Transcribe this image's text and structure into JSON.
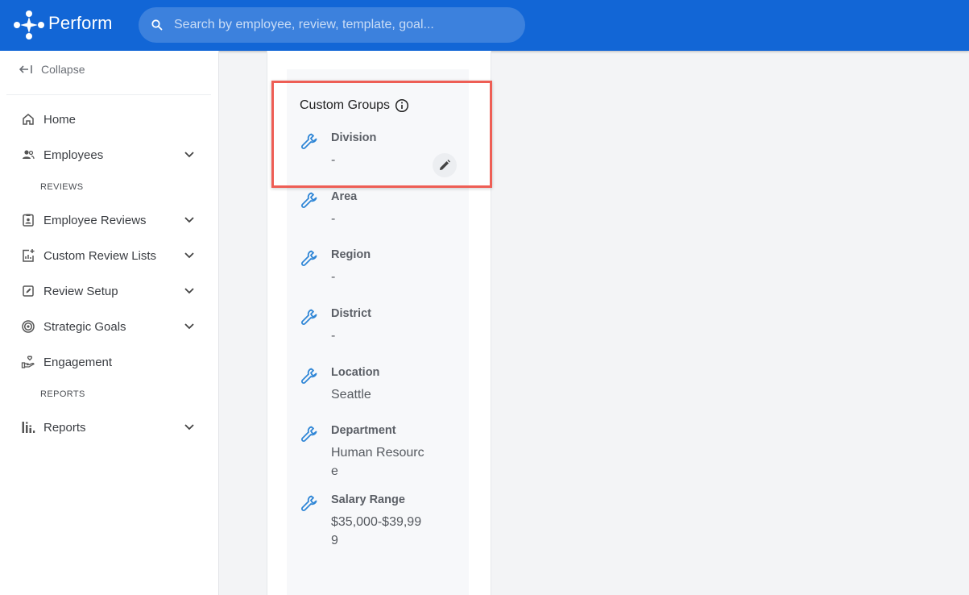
{
  "header": {
    "brand": "Perform",
    "search_placeholder": "Search by employee, review, template, goal..."
  },
  "sidebar": {
    "collapse_label": "Collapse",
    "items": [
      {
        "label": "Home",
        "icon": "home-icon",
        "expandable": false
      },
      {
        "label": "Employees",
        "icon": "people-icon",
        "expandable": true
      },
      {
        "label": "Employee Reviews",
        "icon": "clipboard-icon",
        "expandable": true
      },
      {
        "label": "Custom Review Lists",
        "icon": "chart-plus-icon",
        "expandable": true
      },
      {
        "label": "Review Setup",
        "icon": "edit-square-icon",
        "expandable": true
      },
      {
        "label": "Strategic Goals",
        "icon": "target-icon",
        "expandable": true
      },
      {
        "label": "Engagement",
        "icon": "hand-heart-icon",
        "expandable": false
      },
      {
        "label": "Reports",
        "icon": "bar-chart-icon",
        "expandable": true
      }
    ],
    "sections": {
      "reviews": "REVIEWS",
      "reports": "REPORTS"
    }
  },
  "custom_groups": {
    "title": "Custom Groups",
    "fields": [
      {
        "label": "Division",
        "value": "-"
      },
      {
        "label": "Area",
        "value": "-"
      },
      {
        "label": "Region",
        "value": "-"
      },
      {
        "label": "District",
        "value": "-"
      },
      {
        "label": "Location",
        "value": "Seattle"
      },
      {
        "label": "Department",
        "value": "Human Resource"
      },
      {
        "label": "Salary Range",
        "value": "$35,000-$39,999"
      }
    ]
  },
  "colors": {
    "header": "#1266d6",
    "wrench": "#2f86d6",
    "highlight": "#ee5e55"
  }
}
